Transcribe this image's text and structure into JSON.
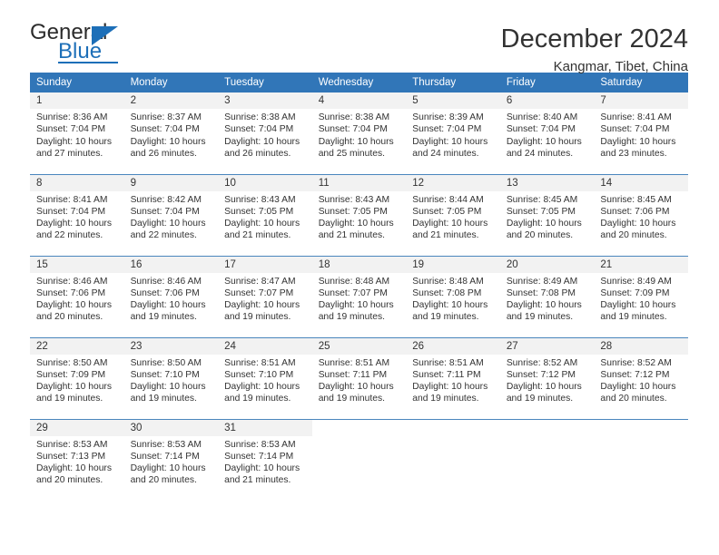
{
  "brand": {
    "name_top": "General",
    "name_bottom": "Blue",
    "accent_color": "#1d6fb8",
    "triangle_icon": "triangle-icon"
  },
  "header": {
    "month_title": "December 2024",
    "location": "Kangmar, Tibet, China"
  },
  "calendar": {
    "header_bg": "#3176b8",
    "daynum_bg": "#f2f2f2",
    "weekday_headers": [
      "Sunday",
      "Monday",
      "Tuesday",
      "Wednesday",
      "Thursday",
      "Friday",
      "Saturday"
    ],
    "weeks": [
      [
        {
          "day": "1",
          "sunrise": "Sunrise: 8:36 AM",
          "sunset": "Sunset: 7:04 PM",
          "daylight1": "Daylight: 10 hours",
          "daylight2": "and 27 minutes."
        },
        {
          "day": "2",
          "sunrise": "Sunrise: 8:37 AM",
          "sunset": "Sunset: 7:04 PM",
          "daylight1": "Daylight: 10 hours",
          "daylight2": "and 26 minutes."
        },
        {
          "day": "3",
          "sunrise": "Sunrise: 8:38 AM",
          "sunset": "Sunset: 7:04 PM",
          "daylight1": "Daylight: 10 hours",
          "daylight2": "and 26 minutes."
        },
        {
          "day": "4",
          "sunrise": "Sunrise: 8:38 AM",
          "sunset": "Sunset: 7:04 PM",
          "daylight1": "Daylight: 10 hours",
          "daylight2": "and 25 minutes."
        },
        {
          "day": "5",
          "sunrise": "Sunrise: 8:39 AM",
          "sunset": "Sunset: 7:04 PM",
          "daylight1": "Daylight: 10 hours",
          "daylight2": "and 24 minutes."
        },
        {
          "day": "6",
          "sunrise": "Sunrise: 8:40 AM",
          "sunset": "Sunset: 7:04 PM",
          "daylight1": "Daylight: 10 hours",
          "daylight2": "and 24 minutes."
        },
        {
          "day": "7",
          "sunrise": "Sunrise: 8:41 AM",
          "sunset": "Sunset: 7:04 PM",
          "daylight1": "Daylight: 10 hours",
          "daylight2": "and 23 minutes."
        }
      ],
      [
        {
          "day": "8",
          "sunrise": "Sunrise: 8:41 AM",
          "sunset": "Sunset: 7:04 PM",
          "daylight1": "Daylight: 10 hours",
          "daylight2": "and 22 minutes."
        },
        {
          "day": "9",
          "sunrise": "Sunrise: 8:42 AM",
          "sunset": "Sunset: 7:04 PM",
          "daylight1": "Daylight: 10 hours",
          "daylight2": "and 22 minutes."
        },
        {
          "day": "10",
          "sunrise": "Sunrise: 8:43 AM",
          "sunset": "Sunset: 7:05 PM",
          "daylight1": "Daylight: 10 hours",
          "daylight2": "and 21 minutes."
        },
        {
          "day": "11",
          "sunrise": "Sunrise: 8:43 AM",
          "sunset": "Sunset: 7:05 PM",
          "daylight1": "Daylight: 10 hours",
          "daylight2": "and 21 minutes."
        },
        {
          "day": "12",
          "sunrise": "Sunrise: 8:44 AM",
          "sunset": "Sunset: 7:05 PM",
          "daylight1": "Daylight: 10 hours",
          "daylight2": "and 21 minutes."
        },
        {
          "day": "13",
          "sunrise": "Sunrise: 8:45 AM",
          "sunset": "Sunset: 7:05 PM",
          "daylight1": "Daylight: 10 hours",
          "daylight2": "and 20 minutes."
        },
        {
          "day": "14",
          "sunrise": "Sunrise: 8:45 AM",
          "sunset": "Sunset: 7:06 PM",
          "daylight1": "Daylight: 10 hours",
          "daylight2": "and 20 minutes."
        }
      ],
      [
        {
          "day": "15",
          "sunrise": "Sunrise: 8:46 AM",
          "sunset": "Sunset: 7:06 PM",
          "daylight1": "Daylight: 10 hours",
          "daylight2": "and 20 minutes."
        },
        {
          "day": "16",
          "sunrise": "Sunrise: 8:46 AM",
          "sunset": "Sunset: 7:06 PM",
          "daylight1": "Daylight: 10 hours",
          "daylight2": "and 19 minutes."
        },
        {
          "day": "17",
          "sunrise": "Sunrise: 8:47 AM",
          "sunset": "Sunset: 7:07 PM",
          "daylight1": "Daylight: 10 hours",
          "daylight2": "and 19 minutes."
        },
        {
          "day": "18",
          "sunrise": "Sunrise: 8:48 AM",
          "sunset": "Sunset: 7:07 PM",
          "daylight1": "Daylight: 10 hours",
          "daylight2": "and 19 minutes."
        },
        {
          "day": "19",
          "sunrise": "Sunrise: 8:48 AM",
          "sunset": "Sunset: 7:08 PM",
          "daylight1": "Daylight: 10 hours",
          "daylight2": "and 19 minutes."
        },
        {
          "day": "20",
          "sunrise": "Sunrise: 8:49 AM",
          "sunset": "Sunset: 7:08 PM",
          "daylight1": "Daylight: 10 hours",
          "daylight2": "and 19 minutes."
        },
        {
          "day": "21",
          "sunrise": "Sunrise: 8:49 AM",
          "sunset": "Sunset: 7:09 PM",
          "daylight1": "Daylight: 10 hours",
          "daylight2": "and 19 minutes."
        }
      ],
      [
        {
          "day": "22",
          "sunrise": "Sunrise: 8:50 AM",
          "sunset": "Sunset: 7:09 PM",
          "daylight1": "Daylight: 10 hours",
          "daylight2": "and 19 minutes."
        },
        {
          "day": "23",
          "sunrise": "Sunrise: 8:50 AM",
          "sunset": "Sunset: 7:10 PM",
          "daylight1": "Daylight: 10 hours",
          "daylight2": "and 19 minutes."
        },
        {
          "day": "24",
          "sunrise": "Sunrise: 8:51 AM",
          "sunset": "Sunset: 7:10 PM",
          "daylight1": "Daylight: 10 hours",
          "daylight2": "and 19 minutes."
        },
        {
          "day": "25",
          "sunrise": "Sunrise: 8:51 AM",
          "sunset": "Sunset: 7:11 PM",
          "daylight1": "Daylight: 10 hours",
          "daylight2": "and 19 minutes."
        },
        {
          "day": "26",
          "sunrise": "Sunrise: 8:51 AM",
          "sunset": "Sunset: 7:11 PM",
          "daylight1": "Daylight: 10 hours",
          "daylight2": "and 19 minutes."
        },
        {
          "day": "27",
          "sunrise": "Sunrise: 8:52 AM",
          "sunset": "Sunset: 7:12 PM",
          "daylight1": "Daylight: 10 hours",
          "daylight2": "and 19 minutes."
        },
        {
          "day": "28",
          "sunrise": "Sunrise: 8:52 AM",
          "sunset": "Sunset: 7:12 PM",
          "daylight1": "Daylight: 10 hours",
          "daylight2": "and 20 minutes."
        }
      ],
      [
        {
          "day": "29",
          "sunrise": "Sunrise: 8:53 AM",
          "sunset": "Sunset: 7:13 PM",
          "daylight1": "Daylight: 10 hours",
          "daylight2": "and 20 minutes."
        },
        {
          "day": "30",
          "sunrise": "Sunrise: 8:53 AM",
          "sunset": "Sunset: 7:14 PM",
          "daylight1": "Daylight: 10 hours",
          "daylight2": "and 20 minutes."
        },
        {
          "day": "31",
          "sunrise": "Sunrise: 8:53 AM",
          "sunset": "Sunset: 7:14 PM",
          "daylight1": "Daylight: 10 hours",
          "daylight2": "and 21 minutes."
        },
        {
          "day": "",
          "sunrise": "",
          "sunset": "",
          "daylight1": "",
          "daylight2": ""
        },
        {
          "day": "",
          "sunrise": "",
          "sunset": "",
          "daylight1": "",
          "daylight2": ""
        },
        {
          "day": "",
          "sunrise": "",
          "sunset": "",
          "daylight1": "",
          "daylight2": ""
        },
        {
          "day": "",
          "sunrise": "",
          "sunset": "",
          "daylight1": "",
          "daylight2": ""
        }
      ]
    ]
  }
}
